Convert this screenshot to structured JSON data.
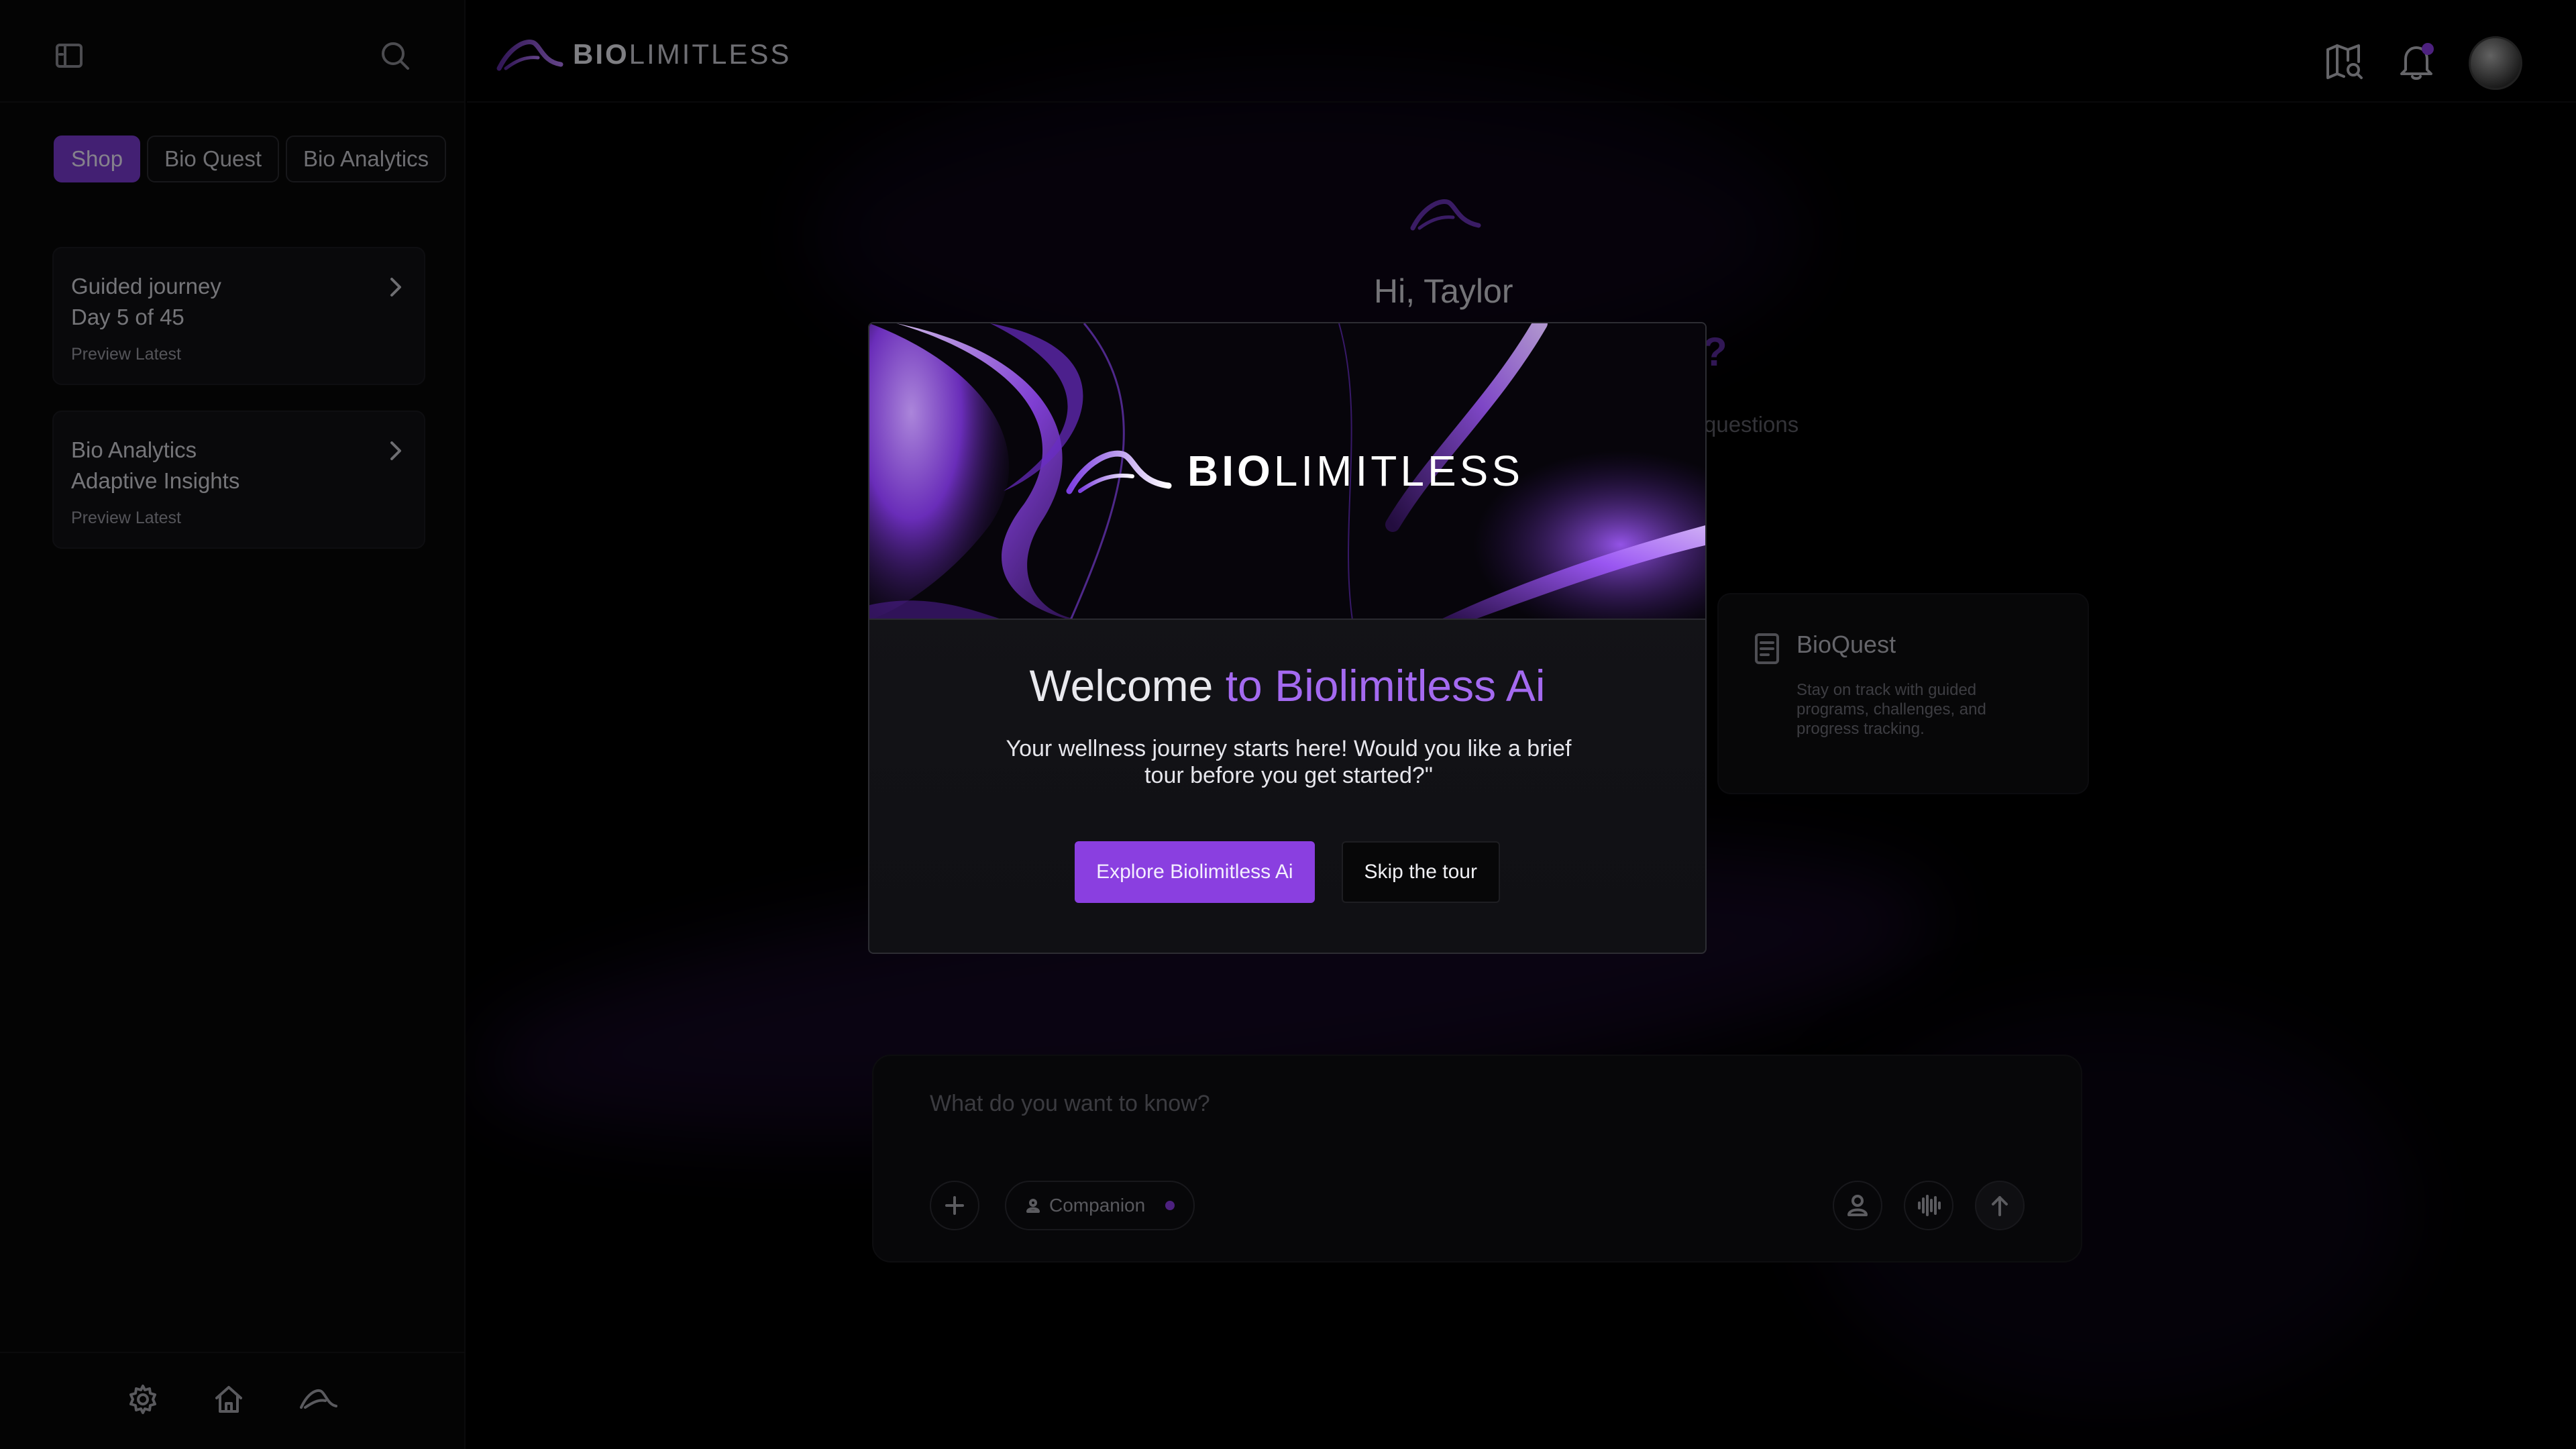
{
  "brand": {
    "bold": "BIO",
    "light": "LIMITLESS"
  },
  "sidebar": {
    "tabs": [
      {
        "label": "Shop",
        "active": true
      },
      {
        "label": "Bio Quest",
        "active": false
      },
      {
        "label": "Bio Analytics",
        "active": false
      }
    ],
    "cards": [
      {
        "line1": "Guided journey",
        "line2": "Day 5 of 45",
        "meta": "Preview Latest"
      },
      {
        "line1": "Bio Analytics",
        "line2": "Adaptive Insights",
        "meta": "Preview Latest"
      }
    ]
  },
  "main": {
    "greeting": "Hi, Taylor",
    "bg_question_mark": "?",
    "bg_questions_fragment": "questions",
    "bioquest_card": {
      "title": "BioQuest",
      "description": "Stay on track with guided programs, challenges, and progress tracking."
    },
    "composer": {
      "placeholder": "What do you want to know?",
      "companion_label": "Companion"
    }
  },
  "modal": {
    "title_plain": "Welcome ",
    "title_accent": "to Biolimitless Ai",
    "subtitle": "Your wellness journey starts here! Would you like a brief tour before you get started?\"",
    "primary_button": "Explore Biolimitless Ai",
    "secondary_button": "Skip the tour"
  },
  "colors": {
    "accent": "#8a3fe0",
    "accent_light": "#a46af0",
    "background": "#000000",
    "notification_dot": "#8d3de8"
  },
  "icons": {
    "sidebar_toggle": "sidebar-toggle-icon",
    "search": "search-icon",
    "map_search": "map-search-icon",
    "bell": "bell-icon",
    "settings": "gear-icon",
    "home": "home-icon",
    "brand": "brand-swoosh-icon"
  }
}
